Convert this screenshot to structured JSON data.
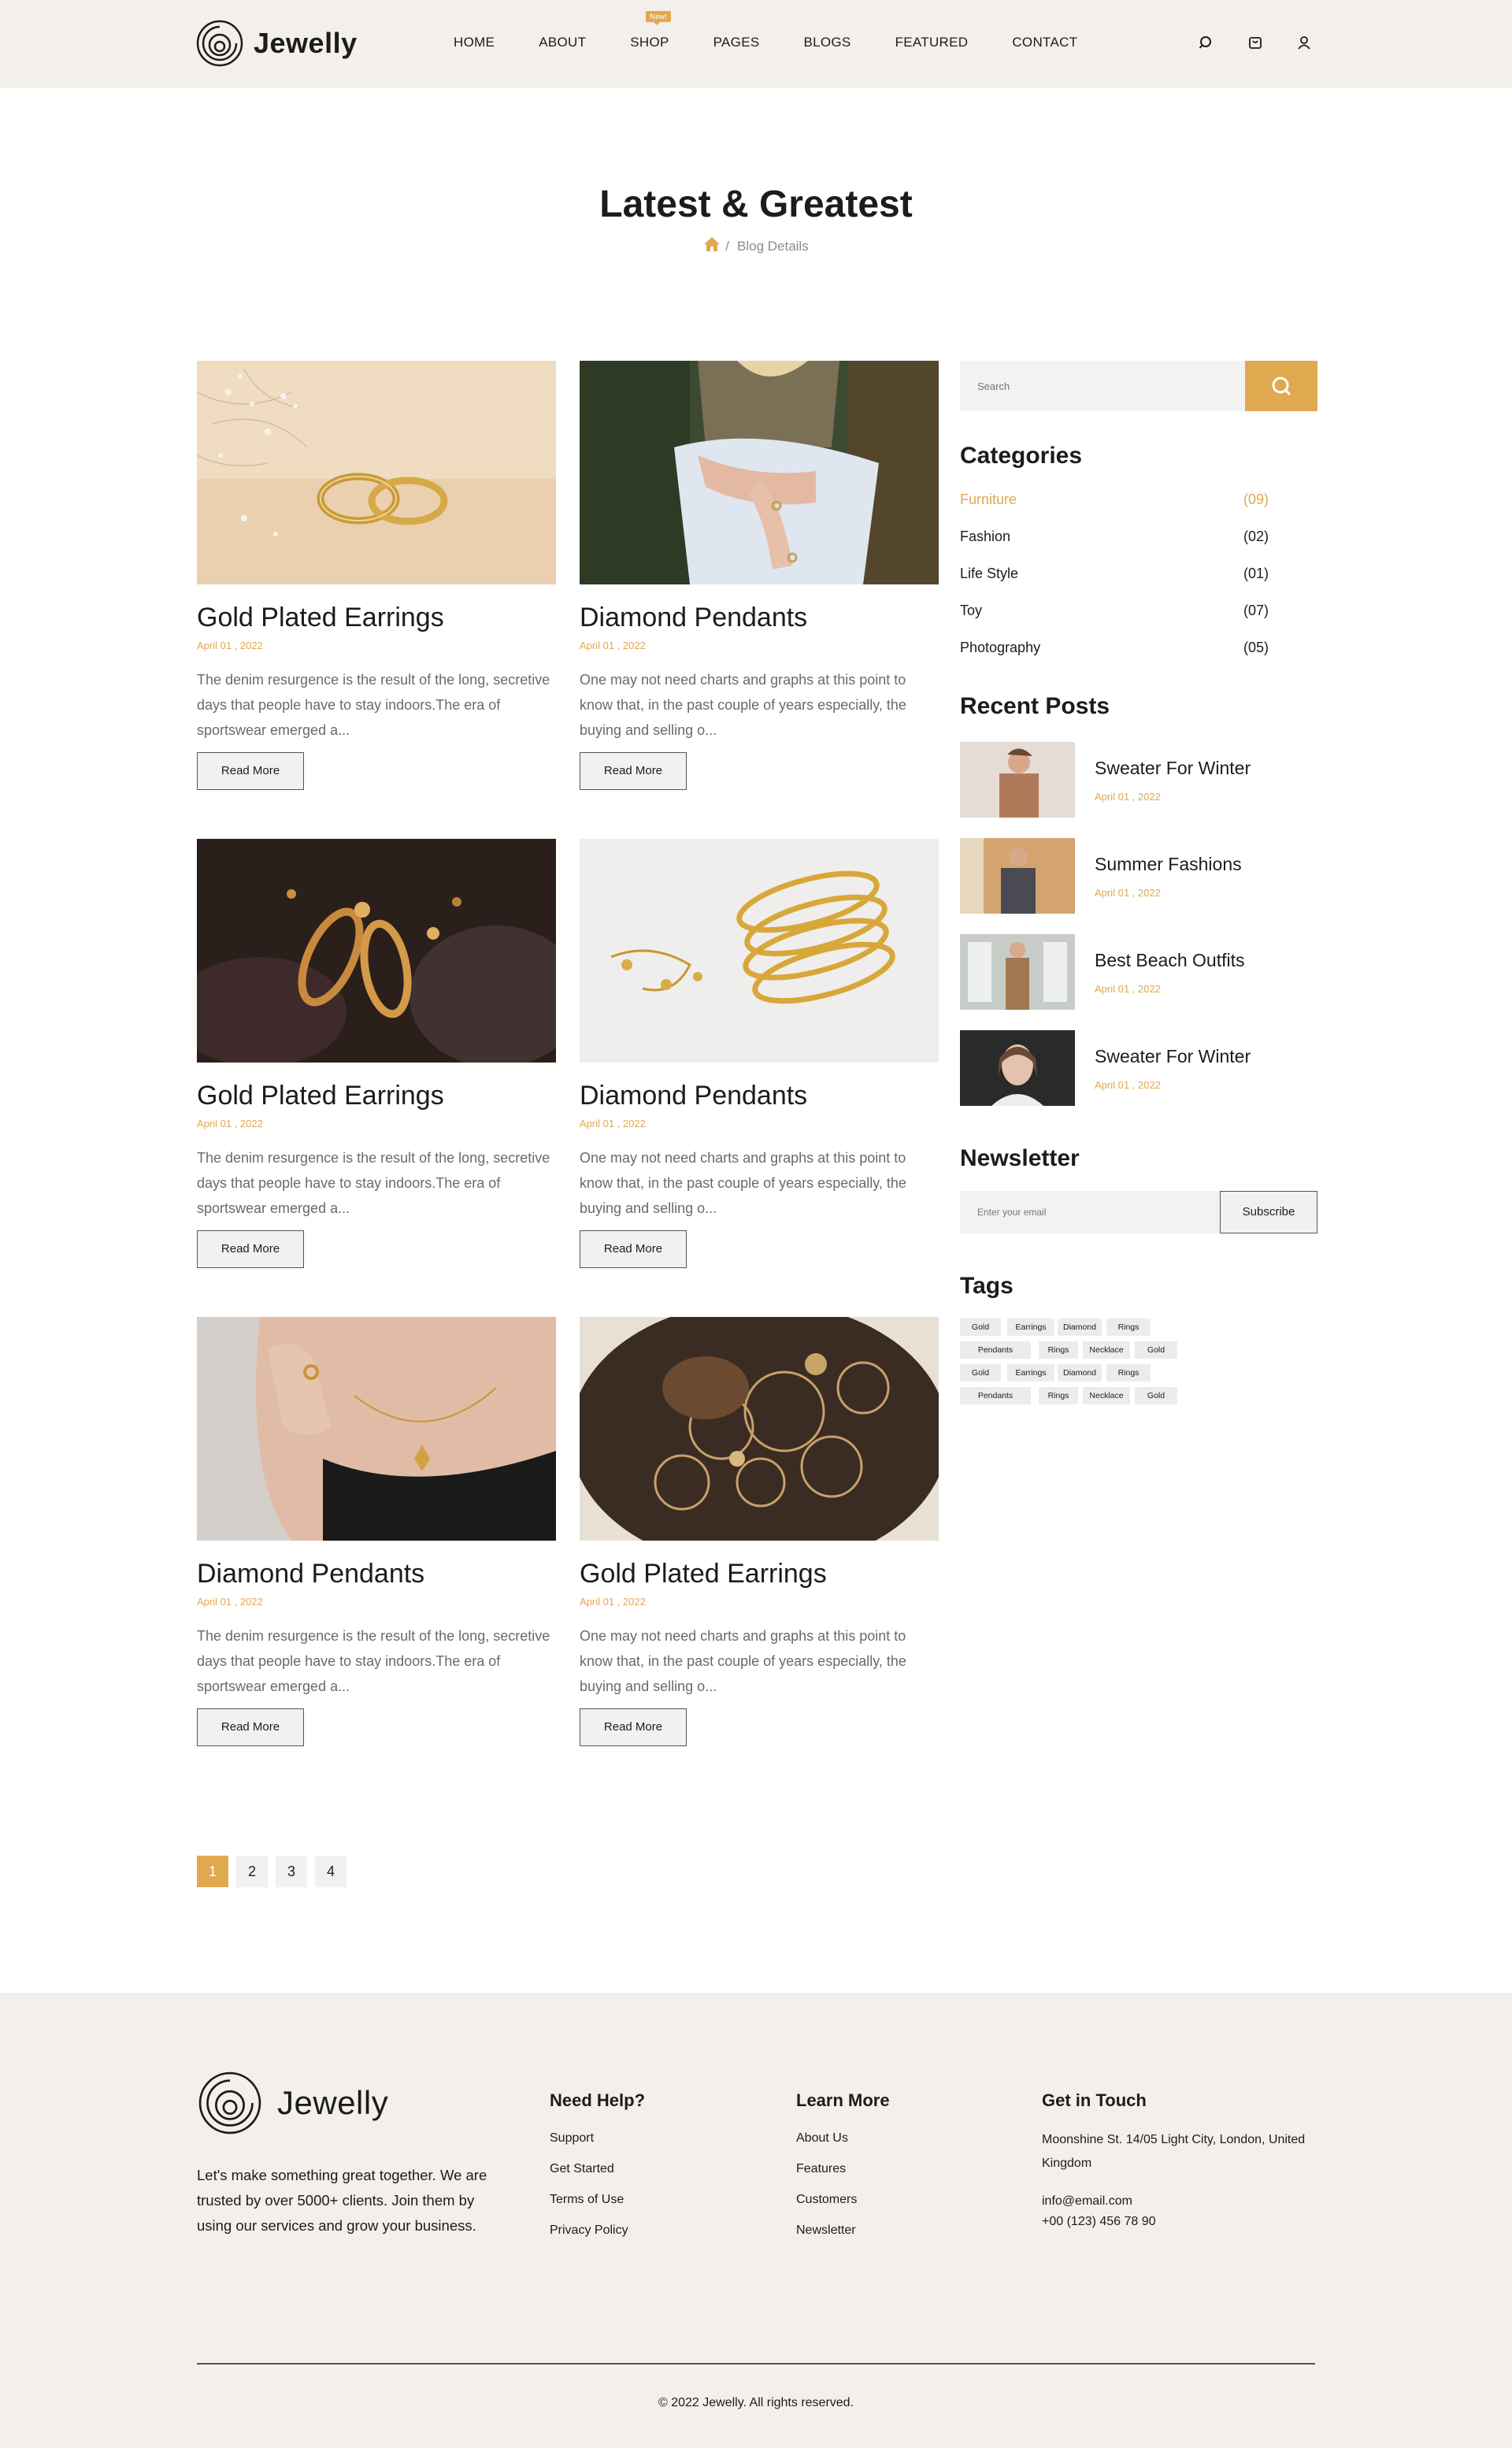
{
  "brand": {
    "name": "Jewelly",
    "accent": "#e0a84f",
    "bg_cream": "#f3efeb"
  },
  "nav": {
    "items": [
      "HOME",
      "ABOUT",
      "SHOP",
      "PAGES",
      "BLOGS",
      "FEATURED",
      "CONTACT"
    ],
    "shop_badge": "New!"
  },
  "header_icons": [
    "search-icon",
    "cart-icon",
    "user-icon"
  ],
  "page": {
    "title": "Latest & Greatest",
    "breadcrumb_current": "Blog Details",
    "breadcrumb_separator": "/"
  },
  "posts": [
    {
      "title": "Gold Plated Earrings",
      "date": "April 01 , 2022",
      "excerpt": "The denim resurgence is the result of the long, secretive days that people have to stay indoors.The era of sportswear emerged a...",
      "button": "Read More"
    },
    {
      "title": "Diamond Pendants",
      "date": "April 01 , 2022",
      "excerpt": "One may not need charts and graphs at this point to know that, in the past couple of years especially, the buying and selling o...",
      "button": "Read More"
    },
    {
      "title": "Gold Plated Earrings",
      "date": "April 01 , 2022",
      "excerpt": "The denim resurgence is the result of the long, secretive days that people have to stay indoors.The era of sportswear emerged a...",
      "button": "Read More"
    },
    {
      "title": "Diamond Pendants",
      "date": "April 01 , 2022",
      "excerpt": "One may not need charts and graphs at this point to know that, in the past couple of years especially, the buying and selling o...",
      "button": "Read More"
    },
    {
      "title": "Diamond Pendants",
      "date": "April 01 , 2022",
      "excerpt": "The denim resurgence is the result of the long, secretive days that people have to stay indoors.The era of sportswear emerged a...",
      "button": "Read More"
    },
    {
      "title": "Gold Plated Earrings",
      "date": "April 01 , 2022",
      "excerpt": "One may not need charts and graphs at this point to know that, in the past couple of years especially, the buying and selling o...",
      "button": "Read More"
    }
  ],
  "sidebar": {
    "search_placeholder": "Search",
    "categories_title": "Categories",
    "categories": [
      {
        "name": "Furniture",
        "count": "(09)"
      },
      {
        "name": "Fashion",
        "count": "(02)"
      },
      {
        "name": "Life Style",
        "count": "(01)"
      },
      {
        "name": "Toy",
        "count": "(07)"
      },
      {
        "name": "Photography",
        "count": "(05)"
      }
    ],
    "recent_title": "Recent Posts",
    "recent": [
      {
        "title": "Sweater For Winter",
        "date": "April 01 , 2022"
      },
      {
        "title": "Summer Fashions",
        "date": "April 01 , 2022"
      },
      {
        "title": "Best Beach Outfits",
        "date": "April 01 , 2022"
      },
      {
        "title": "Sweater For Winter",
        "date": "April 01 , 2022"
      }
    ],
    "newsletter_title": "Newsletter",
    "newsletter_placeholder": "Enter your email",
    "newsletter_button": "Subscribe",
    "tags_title": "Tags",
    "tags": [
      "Gold",
      "Earrings",
      "Diamond",
      "Rings",
      "Pendants",
      "Rings",
      "Necklace",
      "Gold",
      "Gold",
      "Earrings",
      "Diamond",
      "Rings",
      "Pendants",
      "Rings",
      "Necklace",
      "Gold"
    ]
  },
  "pagination": [
    "1",
    "2",
    "3",
    "4"
  ],
  "footer": {
    "brand": "Jewelly",
    "about": "Let's make something great together. We are trusted by over 5000+ clients. Join them by using our services and grow your business.",
    "help_title": "Need Help?",
    "help_links": [
      "Support",
      "Get Started",
      "Terms of Use",
      "Privacy Policy"
    ],
    "learn_title": "Learn More",
    "learn_links": [
      "About Us",
      "Features",
      "Customers",
      "Newsletter"
    ],
    "contact_title": "Get in Touch",
    "address": "Moonshine St. 14/05 Light City, London, United Kingdom",
    "email": "info@email.com",
    "phone": "+00 (123) 456 78 90",
    "copyright": "© 2022 Jewelly. All rights reserved."
  }
}
